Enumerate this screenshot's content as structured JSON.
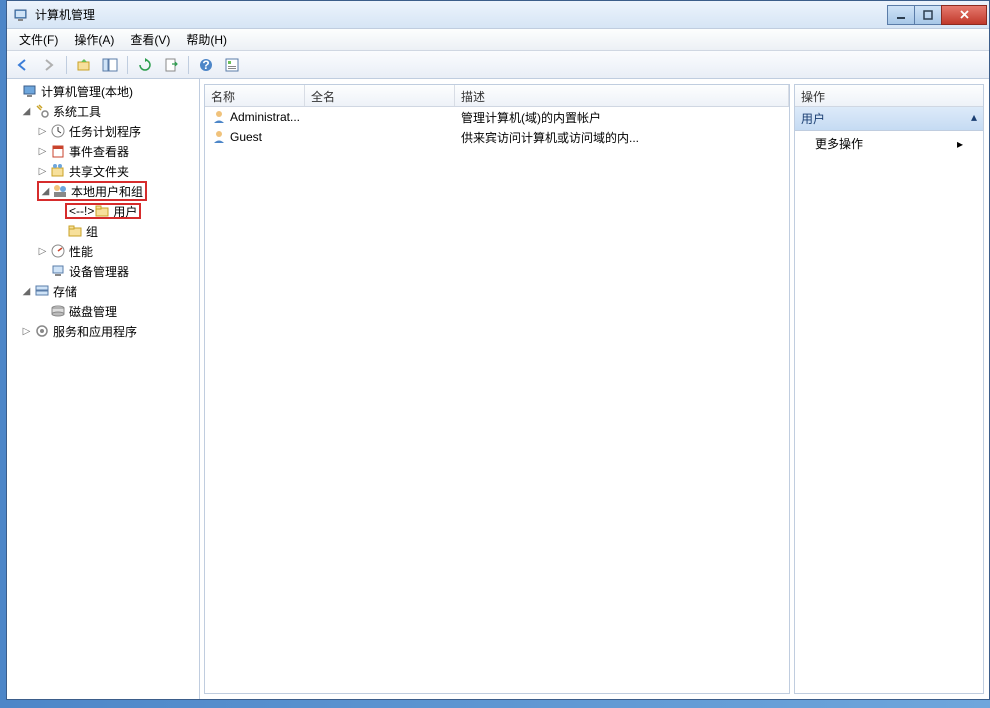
{
  "window": {
    "title": "计算机管理"
  },
  "menu": {
    "file": "文件(F)",
    "action": "操作(A)",
    "view": "查看(V)",
    "help": "帮助(H)"
  },
  "tree": {
    "root": "计算机管理(本地)",
    "system_tools": "系统工具",
    "task_scheduler": "任务计划程序",
    "event_viewer": "事件查看器",
    "shared_folders": "共享文件夹",
    "local_users_groups": "本地用户和组",
    "users": "用户",
    "groups": "组",
    "performance": "性能",
    "device_manager": "设备管理器",
    "storage": "存储",
    "disk_management": "磁盘管理",
    "services_apps": "服务和应用程序"
  },
  "list": {
    "columns": {
      "name": "名称",
      "fullname": "全名",
      "description": "描述"
    },
    "rows": [
      {
        "name": "Administrat...",
        "fullname": "",
        "description": "管理计算机(域)的内置帐户"
      },
      {
        "name": "Guest",
        "fullname": "",
        "description": "供来宾访问计算机或访问域的内..."
      }
    ]
  },
  "actions": {
    "header": "操作",
    "section": "用户",
    "more": "更多操作"
  }
}
